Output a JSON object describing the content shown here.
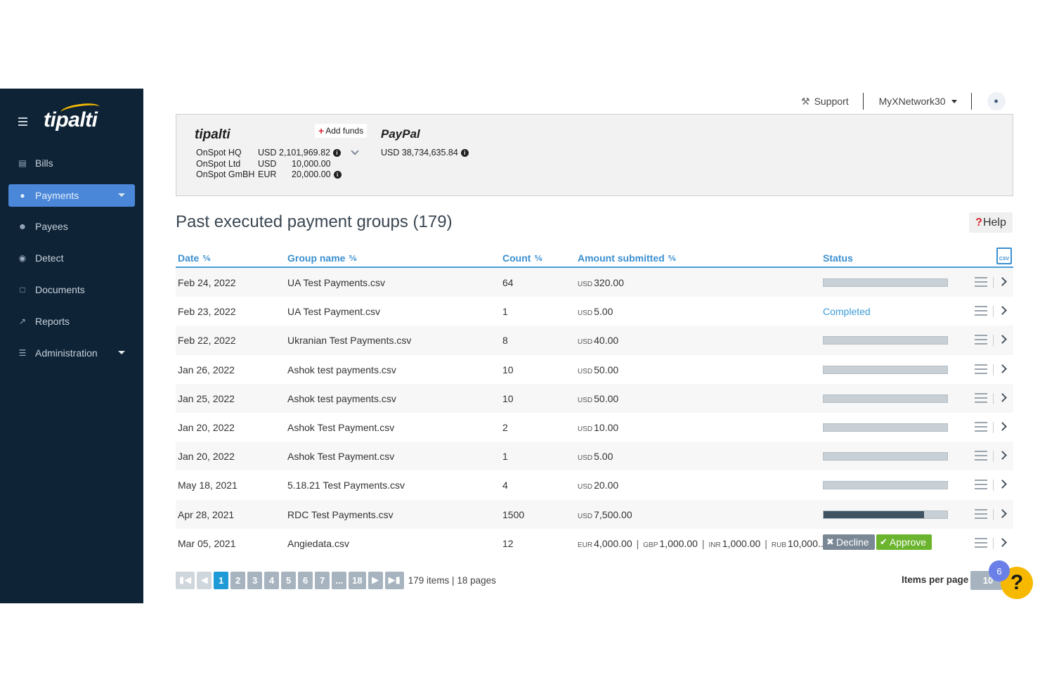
{
  "sidebar": {
    "logo": "tipalti",
    "items": [
      {
        "label": "Bills",
        "icon": "bills-icon"
      },
      {
        "label": "Payments",
        "icon": "payments-icon",
        "active": true
      },
      {
        "label": "Payees",
        "icon": "payees-icon"
      },
      {
        "label": "Detect",
        "icon": "detect-icon"
      },
      {
        "label": "Documents",
        "icon": "documents-icon"
      },
      {
        "label": "Reports",
        "icon": "reports-icon"
      },
      {
        "label": "Administration",
        "icon": "administration-icon"
      }
    ]
  },
  "topbar": {
    "support": "Support",
    "account": "MyXNetwork30"
  },
  "funds": {
    "tipalti_logo": "tipalti",
    "add_funds": "Add funds",
    "accounts": [
      {
        "name": "OnSpot HQ",
        "currency": "USD",
        "amount": "2,101,969.82"
      },
      {
        "name": "OnSpot Ltd",
        "currency": "USD",
        "amount": "10,000.00"
      },
      {
        "name": "OnSpot GmBH",
        "currency": "EUR",
        "amount": "20,000.00"
      }
    ],
    "paypal_logo": "PayPal",
    "paypal": {
      "currency": "USD",
      "amount": "38,734,635.84"
    }
  },
  "page": {
    "title": "Past executed payment groups (179)",
    "help": "Help"
  },
  "table": {
    "headers": {
      "date": "Date",
      "group": "Group name",
      "count": "Count",
      "amount": "Amount submitted",
      "status": "Status"
    },
    "rows": [
      {
        "date": "Feb 24, 2022",
        "group": "UA Test Payments.csv",
        "count": "64",
        "cur": "USD",
        "amount": "320.00",
        "progress": 1.0
      },
      {
        "date": "Feb 23, 2022",
        "group": "UA Test Payment.csv",
        "count": "1",
        "cur": "USD",
        "amount": "5.00",
        "status": "Completed"
      },
      {
        "date": "Feb 22, 2022",
        "group": "Ukranian Test Payments.csv",
        "count": "8",
        "cur": "USD",
        "amount": "40.00",
        "progress": 1.0
      },
      {
        "date": "Jan 26, 2022",
        "group": "Ashok test payments.csv",
        "count": "10",
        "cur": "USD",
        "amount": "50.00",
        "progress": 1.0
      },
      {
        "date": "Jan 25, 2022",
        "group": "Ashok test payments.csv",
        "count": "10",
        "cur": "USD",
        "amount": "50.00",
        "progress": 1.0
      },
      {
        "date": "Jan 20, 2022",
        "group": "Ashok Test Payment.csv",
        "count": "2",
        "cur": "USD",
        "amount": "10.00",
        "progress": 1.0
      },
      {
        "date": "Jan 20, 2022",
        "group": "Ashok Test Payment.csv",
        "count": "1",
        "cur": "USD",
        "amount": "5.00",
        "progress": 1.0
      },
      {
        "date": "May 18, 2021",
        "group": "5.18.21 Test Payments.csv",
        "count": "4",
        "cur": "USD",
        "amount": "20.00",
        "progress": 1.0
      },
      {
        "date": "Apr 28, 2021",
        "group": "RDC Test Payments.csv",
        "count": "1500",
        "cur": "USD",
        "amount": "7,500.00",
        "progress": 0.81,
        "progress_dark": true
      },
      {
        "date": "Mar 05, 2021",
        "group": "Angiedata.csv",
        "count": "12",
        "multi": [
          {
            "cur": "EUR",
            "amount": "4,000.00"
          },
          {
            "cur": "GBP",
            "amount": "1,000.00"
          },
          {
            "cur": "INR",
            "amount": "1,000.00"
          },
          {
            "cur": "RUB",
            "amount": "10,000..."
          }
        ],
        "decline": "Decline",
        "approve": "Approve"
      }
    ]
  },
  "pagination": {
    "pages": [
      "1",
      "2",
      "3",
      "4",
      "5",
      "6",
      "7",
      "...",
      "18"
    ],
    "current": "1",
    "info": "179 items | 18 pages",
    "per_page_label": "Items per page",
    "per_page": "10"
  },
  "help_fab": {
    "badge": "6",
    "glyph": "?"
  },
  "colors": {
    "sidebar_bg": "#0e2336",
    "accent": "#1e9bd7",
    "header_text": "#3a8fd0",
    "approve": "#6ab42e",
    "decline": "#7a8896",
    "fab": "#f7b900"
  }
}
